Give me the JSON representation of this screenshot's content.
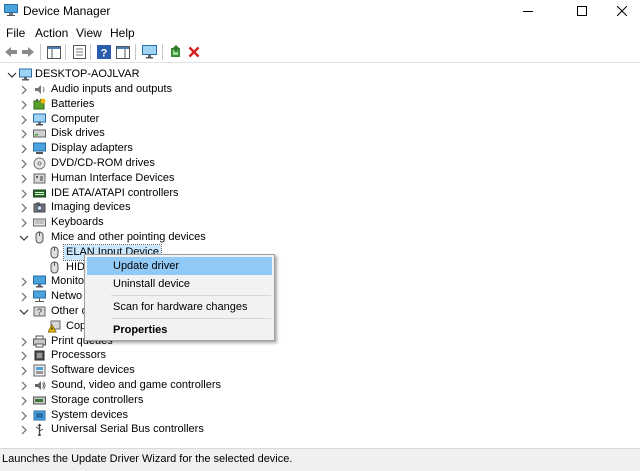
{
  "window": {
    "title": "Device Manager"
  },
  "menu": [
    "File",
    "Action",
    "View",
    "Help"
  ],
  "tree": {
    "root": "DESKTOP-AOJLVAR",
    "items": [
      {
        "label": "Audio inputs and outputs",
        "icon": "speaker-icon"
      },
      {
        "label": "Batteries",
        "icon": "battery-icon"
      },
      {
        "label": "Computer",
        "icon": "computer-icon"
      },
      {
        "label": "Disk drives",
        "icon": "disk-drive-icon"
      },
      {
        "label": "Display adapters",
        "icon": "display-adapter-icon"
      },
      {
        "label": "DVD/CD-ROM drives",
        "icon": "dvd-drive-icon"
      },
      {
        "label": "Human Interface Devices",
        "icon": "hid-icon"
      },
      {
        "label": "IDE ATA/ATAPI controllers",
        "icon": "ide-controller-icon"
      },
      {
        "label": "Imaging devices",
        "icon": "camera-icon"
      },
      {
        "label": "Keyboards",
        "icon": "keyboard-icon"
      },
      {
        "label": "Mice and other pointing devices",
        "icon": "mouse-icon",
        "expanded": true
      },
      {
        "label": "ELAN Input Device",
        "icon": "mouse-icon",
        "child": true,
        "selected": true
      },
      {
        "label": "HID",
        "icon": "mouse-icon",
        "child": true
      },
      {
        "label": "Monito",
        "icon": "monitor-icon"
      },
      {
        "label": "Netwo",
        "icon": "network-icon"
      },
      {
        "label": "Other d",
        "icon": "unknown-device-icon",
        "expanded": true
      },
      {
        "label": "Cop",
        "icon": "warning-device-icon",
        "child": true
      },
      {
        "label": "Print queues",
        "icon": "printer-icon"
      },
      {
        "label": "Processors",
        "icon": "processor-icon"
      },
      {
        "label": "Software devices",
        "icon": "software-device-icon"
      },
      {
        "label": "Sound, video and game controllers",
        "icon": "sound-icon"
      },
      {
        "label": "Storage controllers",
        "icon": "storage-controller-icon"
      },
      {
        "label": "System devices",
        "icon": "system-device-icon"
      },
      {
        "label": "Universal Serial Bus controllers",
        "icon": "usb-icon"
      }
    ]
  },
  "context_menu": {
    "items": [
      "Update driver",
      "Uninstall device",
      "Scan for hardware changes",
      "Properties"
    ],
    "highlighted": "Update driver"
  },
  "status": {
    "text": "Launches the Update Driver Wizard for the selected device."
  },
  "colors": {
    "highlight": "#91c9f7",
    "selection": "#cce8ff",
    "close_red": "#e81123"
  }
}
